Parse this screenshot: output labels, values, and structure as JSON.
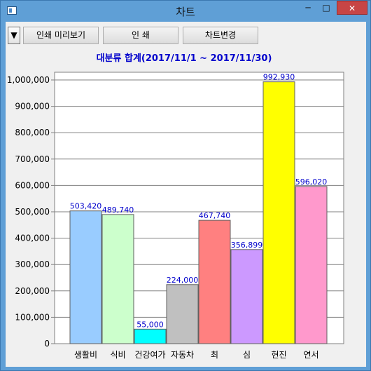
{
  "window": {
    "title": "차트",
    "min_glyph": "─",
    "max_glyph": "□",
    "close_glyph": "✕"
  },
  "toolbar": {
    "dropdown_glyph": "▼",
    "preview_label": "인쇄 미리보기",
    "print_label": "인 쇄",
    "change_label": "차트변경"
  },
  "colors": {
    "title_text": "#0000cc",
    "value_label": "#0000cc",
    "plot_bg": "#ffffff"
  },
  "chart_data": {
    "type": "bar",
    "title": "대분류 합계(2017/11/1 ~ 2017/11/30)",
    "categories": [
      "생활비",
      "식비",
      "건강여가",
      "자동차",
      "최",
      "심",
      "현진",
      "연서"
    ],
    "values": [
      503420,
      489740,
      55000,
      224000,
      467740,
      356899,
      992930,
      596020
    ],
    "value_labels": [
      "503,420",
      "489,740",
      "55,000",
      "224,000",
      "467,740",
      "356,899",
      "992,930",
      "596,020"
    ],
    "bar_colors": [
      "#99ccff",
      "#ccffcc",
      "#00ffff",
      "#c0c0c0",
      "#ff8080",
      "#cc99ff",
      "#ffff00",
      "#ff99cc"
    ],
    "yticks": [
      0,
      100000,
      200000,
      300000,
      400000,
      500000,
      600000,
      700000,
      800000,
      900000,
      1000000
    ],
    "ytick_labels": [
      "0",
      "100,000",
      "200,000",
      "300,000",
      "400,000",
      "500,000",
      "600,000",
      "700,000",
      "800,000",
      "900,000",
      "1,000,000"
    ],
    "ylim": [
      0,
      1000000
    ],
    "grid": true,
    "legend": "none"
  }
}
